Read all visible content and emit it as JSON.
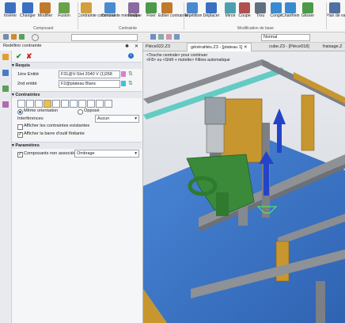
{
  "ribbon": {
    "buttons": [
      {
        "label": "Insérer",
        "name": "inserer-button",
        "icon": "insert-icon"
      },
      {
        "label": "Changer",
        "name": "changer-button",
        "icon": "change-icon"
      },
      {
        "label": "Modifier",
        "name": "modifier-button",
        "icon": "modify-icon"
      },
      {
        "label": "Fusion",
        "name": "fusion-button",
        "icon": "merge-icon"
      },
      {
        "label": "Contrainte commune",
        "name": "contrainte-commune-button",
        "icon": "common-constraint-icon"
      },
      {
        "label": "Contrainte mécanique",
        "name": "contrainte-mecanique-button",
        "icon": "mechanical-constraint-icon"
      },
      {
        "label": "Poulie",
        "name": "poulie-button",
        "icon": "pulley-icon"
      },
      {
        "label": "Fixer",
        "name": "fixer-button",
        "icon": "fix-icon"
      },
      {
        "label": "Editer contrainte",
        "name": "editer-contrainte-button",
        "icon": "edit-constraint-icon"
      },
      {
        "label": "Répétition",
        "name": "repetition-button",
        "icon": "pattern-icon"
      },
      {
        "label": "Déplacer",
        "name": "deplacer-button",
        "icon": "move-icon"
      },
      {
        "label": "Miroir",
        "name": "miroir-button",
        "icon": "mirror-icon"
      },
      {
        "label": "Coupe",
        "name": "coupe-button",
        "icon": "cut-icon"
      },
      {
        "label": "Trou",
        "name": "trou-button",
        "icon": "hole-icon"
      },
      {
        "label": "Congé",
        "name": "conge-button",
        "icon": "fillet-icon"
      },
      {
        "label": "Chanfrein",
        "name": "chanfrein-button",
        "icon": "chamfer-icon"
      },
      {
        "label": "Glisser",
        "name": "glisser-button",
        "icon": "drag-icon"
      },
      {
        "label": "Plan de valeurs",
        "name": "plan-de-valeurs-button",
        "icon": "value-plan-icon"
      }
    ],
    "groups": {
      "composant": "Composant",
      "contrainte": "Contrainte",
      "modification": "Modification de base"
    }
  },
  "toolbar": {
    "display_mode": "Normal"
  },
  "tabs": [
    {
      "label": "Pièce022.Z3"
    },
    {
      "label": "généralités.Z3 - [plateau 1]",
      "active": true
    },
    {
      "label": "cube.Z3 - [Pièce018]"
    },
    {
      "label": "fraisage.Z"
    }
  ],
  "panel": {
    "title": "Redéfinir contrainte",
    "requis": {
      "header": "Requis",
      "entity1_label": "1ère Entité",
      "entity1_value": "F31@V-Slot 2040 V (1)268",
      "entity2_label": "2nd entité",
      "entity2_value": "F2@plateau Blanc"
    },
    "contraintes": {
      "header": "Contraintes",
      "same_orientation": "Même orientation",
      "opposite": "Opposé",
      "interferences_label": "Interférences",
      "interferences_value": "Aucun",
      "show_existing": "Afficher les contraintes existantes",
      "show_floating_bar": "Afficher la barre d'outil flottante"
    },
    "parametres": {
      "header": "Paramètres",
      "unassociated": "Composants non associés",
      "unassociated_value": "Ombrage"
    }
  },
  "viewport": {
    "hint1": "<Touche centrale> pour continuer",
    "hint2": "<F8> ou <Shift + molette> Filtres automatique"
  },
  "colors": {
    "plate_blue": "#3d78c9",
    "rail_gray": "#8a8d92",
    "accent_green": "#3a8a3a",
    "gold": "#c8962e",
    "arrow_blue": "#2444c8"
  }
}
